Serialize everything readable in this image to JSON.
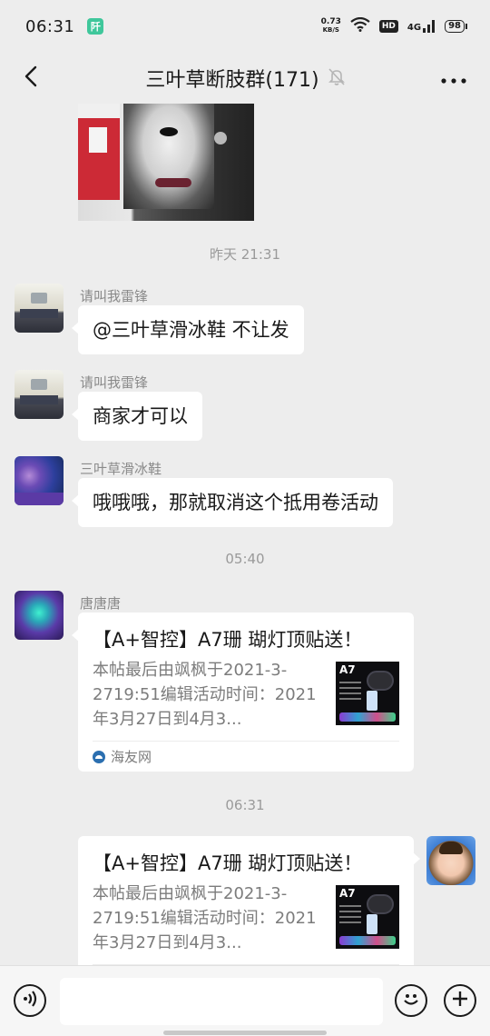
{
  "status_bar": {
    "time": "06:31",
    "app_icon": "阡",
    "net_speed_value": "0.73",
    "net_speed_unit": "KB/S",
    "hd": "HD",
    "signal": "4G",
    "battery": "98"
  },
  "nav": {
    "title": "三叶草断肢群(171)",
    "back_icon": "chevron-left-icon",
    "mute_icon": "bell-off-icon",
    "more_icon": "more-dots-icon"
  },
  "messages": {
    "ts1": "昨天 21:31",
    "m1_sender": "请叫我雷锋",
    "m1_text": "@三叶草滑冰鞋  不让发",
    "m2_sender": "请叫我雷锋",
    "m2_text": "商家才可以",
    "m3_sender": "三叶草滑冰鞋",
    "m3_text": "哦哦哦，那就取消这个抵用卷活动",
    "ts2": "05:40",
    "m4_sender": "唐唐唐",
    "m4_card_title": "【A+智控】A7珊 瑚灯顶贴送！",
    "m4_card_desc": "本帖最后由飒枫于2021-3-2719:51编辑活动时间：2021年3月27日到4月3...",
    "m4_card_source": "海友网",
    "ts3": "06:31",
    "m5_card_title": "【A+智控】A7珊 瑚灯顶贴送！",
    "m5_card_desc": "本帖最后由飒枫于2021-3-2719:51编辑活动时间：2021年3月27日到4月3...",
    "thumb_label": "A7"
  },
  "input": {
    "placeholder": "",
    "voice_icon": "voice-icon",
    "emoji_icon": "emoji-icon",
    "plus_icon": "plus-icon"
  }
}
